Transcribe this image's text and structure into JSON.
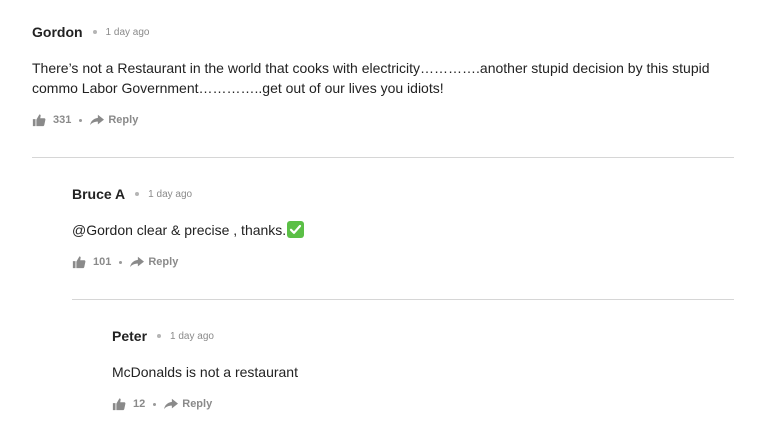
{
  "comments": [
    {
      "author": "Gordon",
      "time": "1 day ago",
      "body": "There’s not a Restaurant in the world that cooks with electricity………….another stupid decision by this stupid commo Labor Government…………..get out of our lives you idiots!",
      "likes": "331",
      "reply_label": "Reply"
    },
    {
      "author": "Bruce A",
      "time": "1 day ago",
      "body": "@Gordon clear & precise , thanks.",
      "emoji": "check-mark-emoji",
      "likes": "101",
      "reply_label": "Reply"
    },
    {
      "author": "Peter",
      "time": "1 day ago",
      "body": "McDonalds is not a restaurant",
      "likes": "12",
      "reply_label": "Reply"
    }
  ],
  "colors": {
    "author": "#222222",
    "meta": "#8a8a8a",
    "divider": "#d6d6d6",
    "check": "#5bbf46"
  }
}
